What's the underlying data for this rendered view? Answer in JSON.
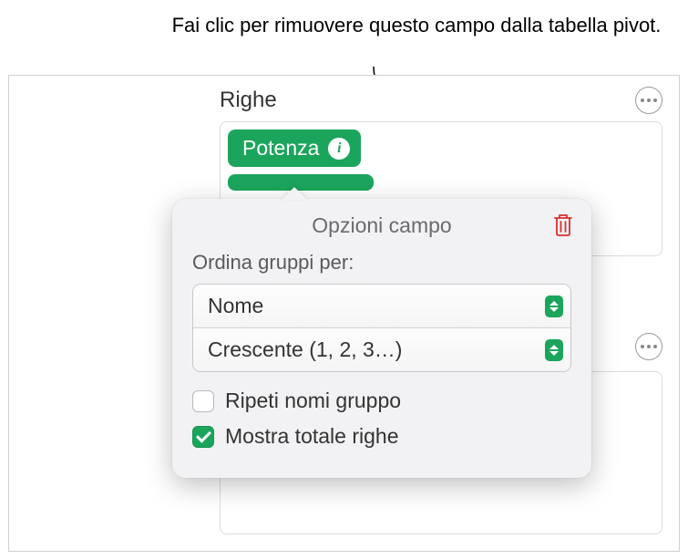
{
  "annotation": "Fai clic per rimuovere questo campo dalla tabella pivot.",
  "section": {
    "title": "Righe"
  },
  "field": {
    "name": "Potenza"
  },
  "popover": {
    "title": "Opzioni campo",
    "sort_label": "Ordina gruppi per:",
    "sort_by": "Nome",
    "sort_order": "Crescente (1, 2, 3…)",
    "repeat_group_names": "Ripeti nomi gruppo",
    "show_row_total": "Mostra totale righe"
  },
  "icons": {
    "info": "i",
    "delete": "trash-icon"
  },
  "colors": {
    "accent": "#1ba55c",
    "danger": "#d9302c"
  }
}
